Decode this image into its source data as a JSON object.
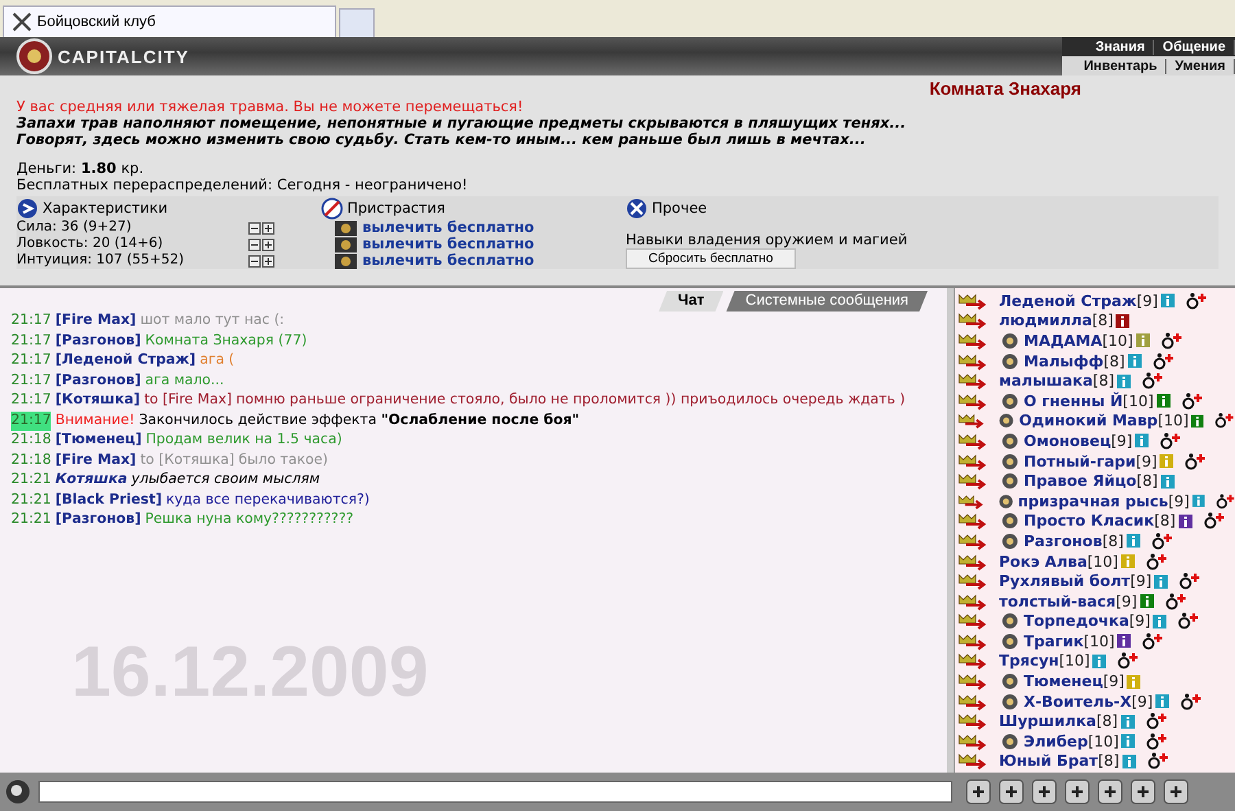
{
  "browser_tab": {
    "title": "Бойцовский клуб"
  },
  "header": {
    "logo": "CAPITALCITY",
    "nav_top": [
      "Знания",
      "Общение"
    ],
    "nav_bottom": [
      "Инвентарь",
      "Умения"
    ]
  },
  "room": {
    "title": "Комната Знахаря",
    "warning": "У вас средняя или тяжелая травма. Вы не можете перемещаться!",
    "description": [
      "Запахи трав наполняют помещение, непонятные и пугающие предметы скрываются в пляшущих тенях...",
      "Говорят, здесь можно изменить свою судьбу. Стать кем-то иным... кем раньше был лишь в мечтах..."
    ],
    "money_label": "Деньги:",
    "money_value": "1.80",
    "money_unit": "кр.",
    "redistributions": "Бесплатных перераспределений: Сегодня - неограничено!"
  },
  "sections": [
    {
      "kind": "stats",
      "title": "Характеристики",
      "stats": [
        "Сила: 36 (9+27)",
        "Ловкость: 20 (14+6)",
        "Интуиция: 107 (55+52)"
      ]
    },
    {
      "kind": "addictions",
      "title": "Пристрастия",
      "links": [
        "вылечить бесплатно",
        "вылечить бесплатно",
        "вылечить бесплатно"
      ]
    },
    {
      "kind": "other",
      "title": "Прочее",
      "label": "Навыки владения оружием и магией",
      "button": "Сбросить бесплатно"
    }
  ],
  "chat_tabs": [
    {
      "label": "Чат",
      "selected": true
    },
    {
      "label": "Системные сообщения",
      "selected": false
    }
  ],
  "chat": [
    {
      "kind": "message",
      "time": "21:17",
      "highlighted": false,
      "author": "[Fire Max]",
      "text": "шот мало тут нас (:",
      "color": "#909090"
    },
    {
      "kind": "message",
      "time": "21:17",
      "highlighted": false,
      "author": "[Разгонов]",
      "text": "Комната Знахаря (77)",
      "color": "#2e9a2e"
    },
    {
      "kind": "message",
      "time": "21:17",
      "highlighted": false,
      "author": "[Леденой Страж]",
      "text": "ага (",
      "color": "#e08030"
    },
    {
      "kind": "message",
      "time": "21:17",
      "highlighted": false,
      "author": "[Разгонов]",
      "text": "ага мало...",
      "color": "#2e9a2e"
    },
    {
      "kind": "private",
      "time": "21:17",
      "highlighted": false,
      "author": "[Котяшка]",
      "to": "to [Fire Max]",
      "text": "помню раньше ограничение стояло, было не проломится )) приъодилось очередь ждать )",
      "color": "#a02030"
    },
    {
      "kind": "system",
      "time": "21:17",
      "highlighted": true,
      "label": "Внимание!",
      "text": "Закончилось действие эффекта **\"Ослабление после боя\"**",
      "color": "#000000"
    },
    {
      "kind": "message",
      "time": "21:18",
      "highlighted": false,
      "author": "[Тюменец]",
      "text": "Продам велик на 1.5 часа)",
      "color": "#2e9a2e"
    },
    {
      "kind": "private",
      "time": "21:18",
      "highlighted": false,
      "author": "[Fire Max]",
      "to": "to [Котяшка]",
      "text": "было такое)",
      "color": "#909090"
    },
    {
      "kind": "action",
      "time": "21:21",
      "highlighted": false,
      "author": "Котяшка",
      "text": "улыбается своим мыслям",
      "color": "#000000"
    },
    {
      "kind": "message",
      "time": "21:21",
      "highlighted": false,
      "author": "[Black Priest]",
      "text": "куда все перекачиваются?)",
      "color": "#20209a"
    },
    {
      "kind": "message",
      "time": "21:21",
      "highlighted": false,
      "author": "[Разгонов]",
      "text": "Решка нуна кому???????????",
      "color": "#2e9a2e"
    }
  ],
  "date_stamp": "16.12.2009",
  "users": [
    {
      "name": "Леденой Страж",
      "level": "[9]",
      "color": "#20a0c0",
      "emblem": false,
      "injured": true
    },
    {
      "name": "людмилла",
      "level": "[8]",
      "color": "#a01010",
      "emblem": false,
      "injured": false
    },
    {
      "name": "МАДАМА",
      "level": "[10]",
      "color": "#a0a040",
      "emblem": true,
      "injured": true
    },
    {
      "name": "Малыфф",
      "level": "[8]",
      "color": "#20a0c0",
      "emblem": true,
      "injured": true
    },
    {
      "name": "малышака",
      "level": "[8]",
      "color": "#20a0c0",
      "emblem": false,
      "injured": true
    },
    {
      "name": "О гненны Й",
      "level": "[10]",
      "color": "#108010",
      "emblem": true,
      "injured": true
    },
    {
      "name": "Одинокий Мавр",
      "level": "[10]",
      "color": "#108010",
      "emblem": true,
      "injured": true
    },
    {
      "name": "Омоновец",
      "level": "[9]",
      "color": "#20a0c0",
      "emblem": true,
      "injured": true
    },
    {
      "name": "Потный-гари",
      "level": "[9]",
      "color": "#d0b010",
      "emblem": true,
      "injured": true
    },
    {
      "name": "Правое Яйцо",
      "level": "[8]",
      "color": "#20a0c0",
      "emblem": true,
      "injured": false
    },
    {
      "name": "призрачная рысь",
      "level": "[9]",
      "color": "#20a0c0",
      "emblem": true,
      "injured": true
    },
    {
      "name": "Просто Класик",
      "level": "[8]",
      "color": "#6030a0",
      "emblem": true,
      "injured": true
    },
    {
      "name": "Разгонов",
      "level": "[8]",
      "color": "#20a0c0",
      "emblem": true,
      "injured": true
    },
    {
      "name": "Рокэ Алва",
      "level": "[10]",
      "color": "#d0b010",
      "emblem": false,
      "injured": true
    },
    {
      "name": "Рухлявый болт",
      "level": "[9]",
      "color": "#20a0c0",
      "emblem": false,
      "injured": true
    },
    {
      "name": "толстый-вася",
      "level": "[9]",
      "color": "#108010",
      "emblem": false,
      "injured": true
    },
    {
      "name": "Торпедочка",
      "level": "[9]",
      "color": "#20a0c0",
      "emblem": true,
      "injured": true
    },
    {
      "name": "Трагик",
      "level": "[10]",
      "color": "#6030a0",
      "emblem": true,
      "injured": true
    },
    {
      "name": "Трясун",
      "level": "[10]",
      "color": "#20a0c0",
      "emblem": false,
      "injured": true
    },
    {
      "name": "Тюменец",
      "level": "[9]",
      "color": "#d0b010",
      "emblem": true,
      "injured": false
    },
    {
      "name": "Х-Воитель-Х",
      "level": "[9]",
      "color": "#20a0c0",
      "emblem": true,
      "injured": true
    },
    {
      "name": "Шуршилка",
      "level": "[8]",
      "color": "#20a0c0",
      "emblem": false,
      "injured": true
    },
    {
      "name": "Элибер",
      "level": "[10]",
      "color": "#20a0c0",
      "emblem": true,
      "injured": true
    },
    {
      "name": "Юный Брат",
      "level": "[8]",
      "color": "#20a0c0",
      "emblem": false,
      "injured": true
    }
  ]
}
